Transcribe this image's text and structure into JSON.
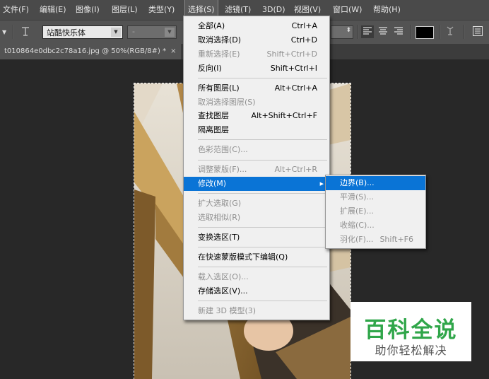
{
  "menubar": {
    "items": [
      "文件(F)",
      "编辑(E)",
      "图像(I)",
      "图层(L)",
      "类型(Y)",
      "选择(S)",
      "滤镜(T)",
      "3D(D)",
      "视图(V)",
      "窗口(W)",
      "帮助(H)"
    ]
  },
  "options": {
    "font_family": "站酷快乐体",
    "font_style": "-"
  },
  "document": {
    "tab_title": "t010864e0dbc2c78a16.jpg @ 50%(RGB/8#) *",
    "close": "×"
  },
  "select_menu": {
    "items": [
      {
        "label": "全部(A)",
        "shortcut": "Ctrl+A",
        "disabled": false
      },
      {
        "label": "取消选择(D)",
        "shortcut": "Ctrl+D",
        "disabled": false
      },
      {
        "label": "重新选择(E)",
        "shortcut": "Shift+Ctrl+D",
        "disabled": true
      },
      {
        "label": "反向(I)",
        "shortcut": "Shift+Ctrl+I",
        "disabled": false
      },
      {
        "label": "所有图层(L)",
        "shortcut": "Alt+Ctrl+A",
        "disabled": false
      },
      {
        "label": "取消选择图层(S)",
        "shortcut": "",
        "disabled": true
      },
      {
        "label": "查找图层",
        "shortcut": "Alt+Shift+Ctrl+F",
        "disabled": false
      },
      {
        "label": "隔离图层",
        "shortcut": "",
        "disabled": false
      },
      {
        "label": "色彩范围(C)...",
        "shortcut": "",
        "disabled": true
      },
      {
        "label": "调整蒙版(F)...",
        "shortcut": "Alt+Ctrl+R",
        "disabled": true
      },
      {
        "label": "修改(M)",
        "shortcut": "",
        "disabled": false,
        "highlighted": true,
        "submenu": true
      },
      {
        "label": "扩大选取(G)",
        "shortcut": "",
        "disabled": true
      },
      {
        "label": "选取相似(R)",
        "shortcut": "",
        "disabled": true
      },
      {
        "label": "变换选区(T)",
        "shortcut": "",
        "disabled": false
      },
      {
        "label": "在快速蒙版模式下编辑(Q)",
        "shortcut": "",
        "disabled": false
      },
      {
        "label": "载入选区(O)...",
        "shortcut": "",
        "disabled": true
      },
      {
        "label": "存储选区(V)...",
        "shortcut": "",
        "disabled": false
      },
      {
        "label": "新建 3D 模型(3)",
        "shortcut": "",
        "disabled": true
      }
    ]
  },
  "modify_submenu": {
    "items": [
      {
        "label": "边界(B)...",
        "shortcut": "",
        "highlighted": true
      },
      {
        "label": "平滑(S)...",
        "shortcut": "",
        "disabled": true
      },
      {
        "label": "扩展(E)...",
        "shortcut": "",
        "disabled": true
      },
      {
        "label": "收缩(C)...",
        "shortcut": "",
        "disabled": true
      },
      {
        "label": "羽化(F)...",
        "shortcut": "Shift+F6",
        "disabled": true
      }
    ]
  },
  "watermark": {
    "title": "百科全说",
    "subtitle": "助你轻松解决"
  },
  "colors": {
    "highlight": "#0a74d6",
    "watermark_green": "#30a64a"
  }
}
